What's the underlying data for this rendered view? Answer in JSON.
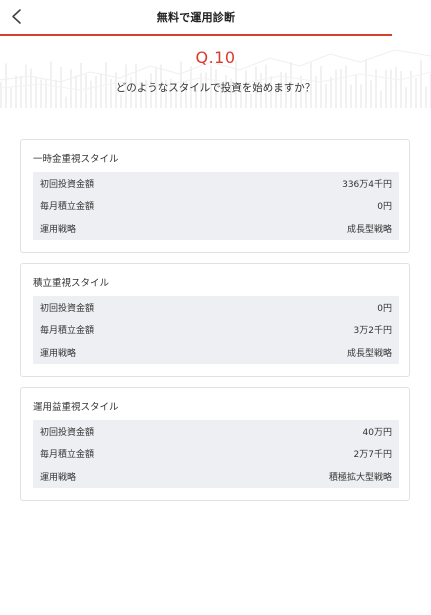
{
  "header": {
    "title": "無料で運用診断"
  },
  "question": {
    "number": "Q.10",
    "text": "どのようなスタイルで投資を始めますか？"
  },
  "options": [
    {
      "title": "一時金重視スタイル",
      "rows": [
        {
          "label": "初回投資金額",
          "value": "336万4千円"
        },
        {
          "label": "毎月積立金額",
          "value": "0円"
        },
        {
          "label": "運用戦略",
          "value": "成長型戦略"
        }
      ]
    },
    {
      "title": "積立重視スタイル",
      "rows": [
        {
          "label": "初回投資金額",
          "value": "0円"
        },
        {
          "label": "毎月積立金額",
          "value": "3万2千円"
        },
        {
          "label": "運用戦略",
          "value": "成長型戦略"
        }
      ]
    },
    {
      "title": "運用益重視スタイル",
      "rows": [
        {
          "label": "初回投資金額",
          "value": "40万円"
        },
        {
          "label": "毎月積立金額",
          "value": "2万7千円"
        },
        {
          "label": "運用戦略",
          "value": "積極拡大型戦略"
        }
      ]
    }
  ],
  "colors": {
    "accent": "#d93a2b",
    "header_rule": "#d6402f",
    "table_bg": "#eeeff2",
    "card_border": "#e2e2e2"
  },
  "icons": {
    "back": "chevron-left-icon"
  }
}
